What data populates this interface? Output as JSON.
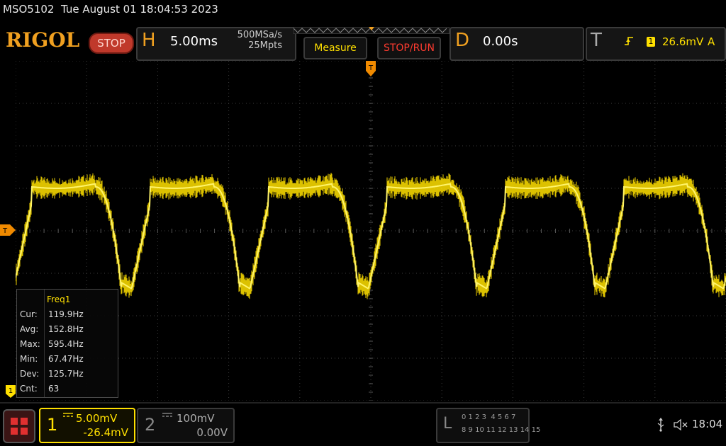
{
  "header": {
    "title_line": "MSO5102  Tue August 01 18:04:53 2023",
    "brand": "RIGOL",
    "run_state": "STOP"
  },
  "horizontal": {
    "letter": "H",
    "timebase": "5.00ms",
    "sample_rate": "500MSa/s",
    "memory_depth": "25Mpts"
  },
  "buttons": {
    "measure": "Measure",
    "stop_run": "STOP/RUN"
  },
  "delay": {
    "letter": "D",
    "value": "0.00s"
  },
  "trigger": {
    "letter": "T",
    "edge_icon": "rising-edge-icon",
    "source": "1",
    "level": "26.6mV",
    "mode": "A",
    "marker_label": "T"
  },
  "measurements": {
    "title": "Freq1",
    "rows": [
      {
        "label": "Cur:",
        "value": "119.9Hz"
      },
      {
        "label": "Avg:",
        "value": "152.8Hz"
      },
      {
        "label": "Max:",
        "value": "595.4Hz"
      },
      {
        "label": "Min:",
        "value": "67.47Hz"
      },
      {
        "label": "Dev:",
        "value": "125.7Hz"
      },
      {
        "label": "Cnt:",
        "value": "63"
      }
    ]
  },
  "channel1": {
    "number": "1",
    "coupling_icon": "dc-coupling-icon",
    "scale": "5.00mV",
    "offset": "-26.4mV",
    "color": "#ffe000",
    "marker_label": "1"
  },
  "channel2": {
    "number": "2",
    "coupling_icon": "dc-coupling-icon",
    "scale": "100mV",
    "offset": "0.00V"
  },
  "logic": {
    "letter": "L",
    "row1": "0 1 2 3  4 5 6 7",
    "row2": "8 9 10 11 12 13 14 15"
  },
  "status": {
    "clock": "18:04"
  },
  "waveform": {
    "period_ms": 8.34,
    "shape": "flat top with sharp downward notch"
  }
}
